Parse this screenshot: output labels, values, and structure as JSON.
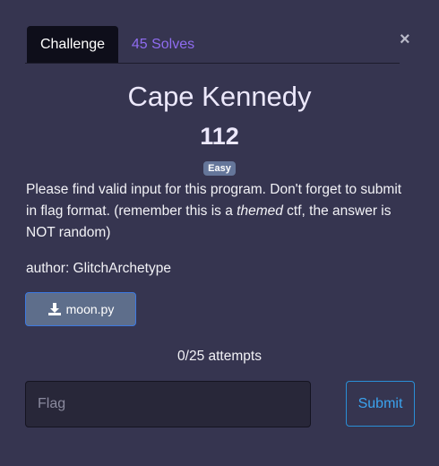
{
  "close_symbol": "×",
  "tabs": [
    {
      "label": "Challenge",
      "active": true
    },
    {
      "label": "45 Solves",
      "active": false
    }
  ],
  "challenge": {
    "title": "Cape Kennedy",
    "points": "112",
    "difficulty": "Easy",
    "description": {
      "before": "Please find valid input for this program. Don't forget to submit in flag format. (remember this is a ",
      "emphasis": "themed",
      "after": " ctf, the answer is NOT random)"
    },
    "author": "author: GlitchArchetype",
    "file": {
      "name": "moon.py",
      "icon": "download-icon"
    },
    "attempts": "0/25 attempts"
  },
  "form": {
    "flag_placeholder": "Flag",
    "flag_value": "",
    "submit_label": "Submit"
  },
  "colors": {
    "background": "#363550",
    "tab_active": "#0e0e1a",
    "solves_link": "#8f6cf0",
    "badge": "#65769a",
    "download_button": "#5e6e8b",
    "submit_border": "#2a8fd6"
  }
}
